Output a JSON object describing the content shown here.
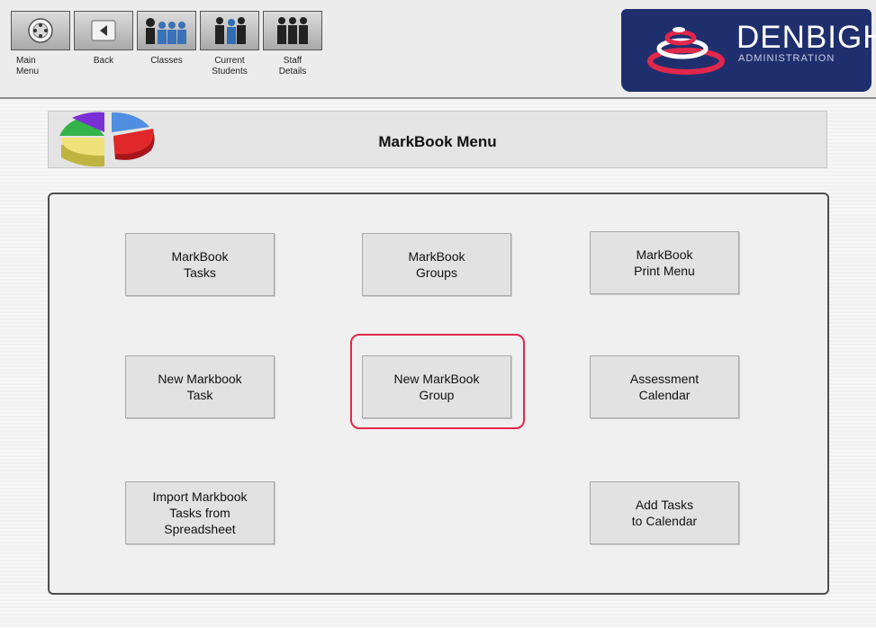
{
  "toolbar": {
    "items": [
      {
        "label": "Main\nMenu",
        "icon": "main-menu-icon"
      },
      {
        "label": "Back",
        "icon": "back-arrow-icon"
      },
      {
        "label": "Classes",
        "icon": "classes-icon"
      },
      {
        "label": "Current\nStudents",
        "icon": "current-students-icon"
      },
      {
        "label": "Staff\nDetails",
        "icon": "staff-details-icon"
      }
    ]
  },
  "brand": {
    "name": "DENBIGH",
    "subtitle": "ADMINISTRATION",
    "background_color": "#1f2f6e",
    "logo_accent_color": "#e0284a"
  },
  "header": {
    "title": "MarkBook Menu",
    "icon": "pie-chart-icon"
  },
  "menu": {
    "buttons": [
      {
        "label": "MarkBook\nTasks"
      },
      {
        "label": "MarkBook\nGroups"
      },
      {
        "label": "MarkBook\nPrint Menu"
      },
      {
        "label": "New Markbook\nTask"
      },
      {
        "label": "New MarkBook\nGroup"
      },
      {
        "label": "Assessment\nCalendar"
      },
      {
        "label": "Import Markbook\nTasks from\nSpreadsheet"
      },
      {
        "label": "Add Tasks\nto Calendar"
      }
    ],
    "highlighted": "New MarkBook\nGroup",
    "highlight_color": "#e0284a"
  }
}
